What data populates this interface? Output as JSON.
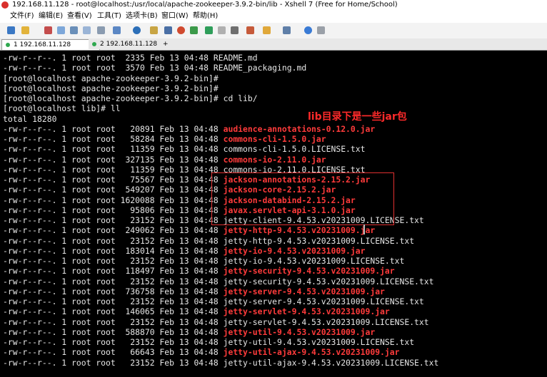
{
  "window": {
    "title": "192.168.11.128 - root@localhost:/usr/local/apache-zookeeper-3.9.2-bin/lib - Xshell 7 (Free for Home/School)"
  },
  "menu": [
    "文件(F)",
    "编辑(E)",
    "查看(V)",
    "工具(T)",
    "选项卡(B)",
    "窗口(W)",
    "帮助(H)"
  ],
  "tabs": [
    {
      "label": "1 192.168.11.128",
      "color": "#2fa84f",
      "active": true
    },
    {
      "label": "2 192.168.11.128",
      "color": "#2fa84f",
      "active": false
    }
  ],
  "new_tab_label": "+",
  "tab_close_label": "×",
  "annotation": {
    "text": "lib目录下是一些jar包",
    "color": "#ff2a2a"
  },
  "terminal": {
    "lines": [
      {
        "prefix": "-rw-r--r--. 1 root root  2335 Feb 13 04:48 ",
        "file": "README.md",
        "jar": false
      },
      {
        "prefix": "-rw-r--r--. 1 root root  3570 Feb 13 04:48 ",
        "file": "README_packaging.md",
        "jar": false
      },
      {
        "prefix": "[root@localhost apache-zookeeper-3.9.2-bin]#",
        "file": "",
        "jar": false
      },
      {
        "prefix": "[root@localhost apache-zookeeper-3.9.2-bin]#",
        "file": "",
        "jar": false
      },
      {
        "prefix": "[root@localhost apache-zookeeper-3.9.2-bin]# cd lib/",
        "file": "",
        "jar": false
      },
      {
        "prefix": "[root@localhost lib]# ll",
        "file": "",
        "jar": false
      },
      {
        "prefix": "total 18280",
        "file": "",
        "jar": false
      },
      {
        "prefix": "-rw-r--r--. 1 root root   20891 Feb 13 04:48 ",
        "file": "audience-annotations-0.12.0.jar",
        "jar": true
      },
      {
        "prefix": "-rw-r--r--. 1 root root   58284 Feb 13 04:48 ",
        "file": "commons-cli-1.5.0.jar",
        "jar": true
      },
      {
        "prefix": "-rw-r--r--. 1 root root   11359 Feb 13 04:48 ",
        "file": "commons-cli-1.5.0.LICENSE.txt",
        "jar": false
      },
      {
        "prefix": "-rw-r--r--. 1 root root  327135 Feb 13 04:48 ",
        "file": "commons-io-2.11.0.jar",
        "jar": true
      },
      {
        "prefix": "-rw-r--r--. 1 root root   11359 Feb 13 04:48 ",
        "file": "commons-io-2.11.0.LICENSE.txt",
        "jar": false
      },
      {
        "prefix": "-rw-r--r--. 1 root root   75567 Feb 13 04:48 ",
        "file": "jackson-annotations-2.15.2.jar",
        "jar": true
      },
      {
        "prefix": "-rw-r--r--. 1 root root  549207 Feb 13 04:48 ",
        "file": "jackson-core-2.15.2.jar",
        "jar": true
      },
      {
        "prefix": "-rw-r--r--. 1 root root 1620088 Feb 13 04:48 ",
        "file": "jackson-databind-2.15.2.jar",
        "jar": true
      },
      {
        "prefix": "-rw-r--r--. 1 root root   95806 Feb 13 04:48 ",
        "file": "javax.servlet-api-3.1.0.jar",
        "jar": true
      },
      {
        "prefix": "-rw-r--r--. 1 root root   23152 Feb 13 04:48 ",
        "file": "jetty-client-9.4.53.v20231009.LICENSE.txt",
        "jar": false
      },
      {
        "prefix": "-rw-r--r--. 1 root root  249062 Feb 13 04:48 ",
        "file": "jetty-http-9.4.53.v20231009.jar",
        "jar": true
      },
      {
        "prefix": "-rw-r--r--. 1 root root   23152 Feb 13 04:48 ",
        "file": "jetty-http-9.4.53.v20231009.LICENSE.txt",
        "jar": false
      },
      {
        "prefix": "-rw-r--r--. 1 root root  183014 Feb 13 04:48 ",
        "file": "jetty-io-9.4.53.v20231009.jar",
        "jar": true
      },
      {
        "prefix": "-rw-r--r--. 1 root root   23152 Feb 13 04:48 ",
        "file": "jetty-io-9.4.53.v20231009.LICENSE.txt",
        "jar": false
      },
      {
        "prefix": "-rw-r--r--. 1 root root  118497 Feb 13 04:48 ",
        "file": "jetty-security-9.4.53.v20231009.jar",
        "jar": true
      },
      {
        "prefix": "-rw-r--r--. 1 root root   23152 Feb 13 04:48 ",
        "file": "jetty-security-9.4.53.v20231009.LICENSE.txt",
        "jar": false
      },
      {
        "prefix": "-rw-r--r--. 1 root root  736758 Feb 13 04:48 ",
        "file": "jetty-server-9.4.53.v20231009.jar",
        "jar": true
      },
      {
        "prefix": "-rw-r--r--. 1 root root   23152 Feb 13 04:48 ",
        "file": "jetty-server-9.4.53.v20231009.LICENSE.txt",
        "jar": false
      },
      {
        "prefix": "-rw-r--r--. 1 root root  146065 Feb 13 04:48 ",
        "file": "jetty-servlet-9.4.53.v20231009.jar",
        "jar": true
      },
      {
        "prefix": "-rw-r--r--. 1 root root   23152 Feb 13 04:48 ",
        "file": "jetty-servlet-9.4.53.v20231009.LICENSE.txt",
        "jar": false
      },
      {
        "prefix": "-rw-r--r--. 1 root root  588870 Feb 13 04:48 ",
        "file": "jetty-util-9.4.53.v20231009.jar",
        "jar": true
      },
      {
        "prefix": "-rw-r--r--. 1 root root   23152 Feb 13 04:48 ",
        "file": "jetty-util-9.4.53.v20231009.LICENSE.txt",
        "jar": false
      },
      {
        "prefix": "-rw-r--r--. 1 root root   66643 Feb 13 04:48 ",
        "file": "jetty-util-ajax-9.4.53.v20231009.jar",
        "jar": true
      },
      {
        "prefix": "-rw-r--r--. 1 root root   23152 Feb 13 04:48 ",
        "file": "jetty-util-ajax-9.4.53.v20231009.LICENSE.txt",
        "jar": false
      }
    ]
  },
  "toolbar_icons": [
    "new-session-icon",
    "open-folder-icon",
    "disconnect-icon",
    "reconnect-icon",
    "properties-icon",
    "copy-icon",
    "paste-icon",
    "find-icon",
    "print-icon",
    "globe-icon",
    "lock-icon",
    "font-icon",
    "xftp-icon",
    "xagent-icon",
    "fullscreen-icon",
    "key-icon",
    "compose-icon",
    "transfer-icon",
    "tile-icon",
    "split-icon",
    "help-icon",
    "settings-icon"
  ]
}
